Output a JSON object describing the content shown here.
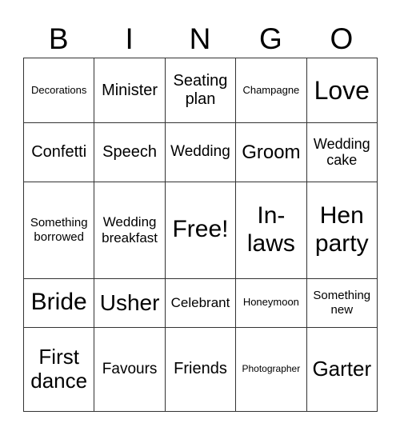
{
  "header": [
    "B",
    "I",
    "N",
    "G",
    "O"
  ],
  "cells": [
    [
      "Decorations",
      "Minister",
      "Seating plan",
      "Champagne",
      "Love"
    ],
    [
      "Confetti",
      "Speech",
      "Wedding",
      "Groom",
      "Wedding cake"
    ],
    [
      "Something borrowed",
      "Wedding breakfast",
      "Free!",
      "In-laws",
      "Hen party"
    ],
    [
      "Bride",
      "Usher",
      "Celebrant",
      "Honeymoon",
      "Something new"
    ],
    [
      "First dance",
      "Favours",
      "Friends",
      "Photographer",
      "Garter"
    ]
  ]
}
